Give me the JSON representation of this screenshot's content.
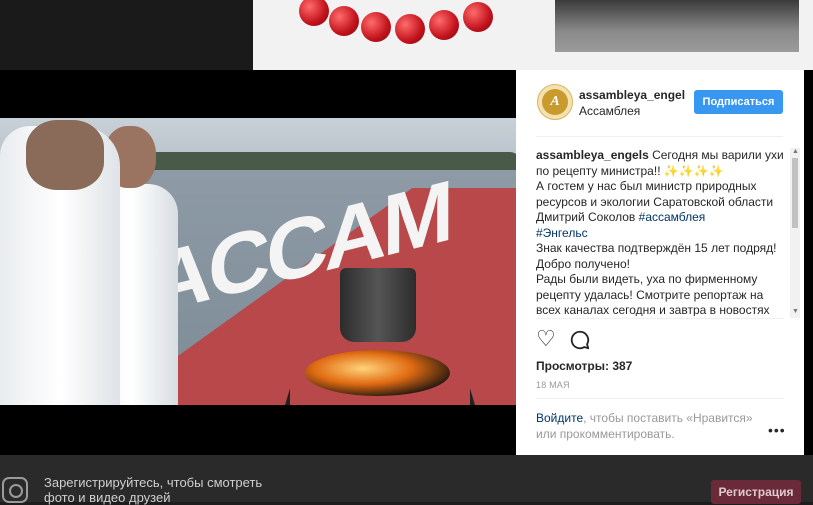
{
  "colors": {
    "follow_bg": "#3897f0",
    "link": "#003569",
    "overlay": "#000000"
  },
  "post": {
    "username": "assambleya_engel",
    "location": "Ассамблея",
    "follow_label": "Подписаться",
    "caption": {
      "author": "assambleya_engels",
      "text1": " Сегодня мы варили ухи по рецепту министра!! ",
      "emoji": "✨✨✨✨",
      "text2": "А гостем у нас был министр природных ресурсов и экологии Саратовской области Дмитрий Соколов ",
      "tag1": "#ассамблея",
      "tag2": "#Энгельс",
      "text3": "Знак качества подтверждён 15 лет подряд! Добро получено!",
      "text4": "Рады были видеть, уха по фирменному рецепту удалась! Смотрите репортаж на всех каналах сегодня и завтра в новостях"
    },
    "views_label": "Просмотры: 387",
    "date": "18 МАЯ",
    "login_link": "Войдите",
    "login_text": ", чтобы поставить «Нравится» или прокомментировать.",
    "more_label": "•••",
    "video_sign": "ACCAM"
  },
  "footer": {
    "text": "Зарегистрируйтесь, чтобы смотреть фото и видео друзей",
    "register_label": "Регистрация"
  },
  "icons": [
    "heart-icon",
    "comment-icon",
    "instagram-icon",
    "avatar-logo"
  ]
}
